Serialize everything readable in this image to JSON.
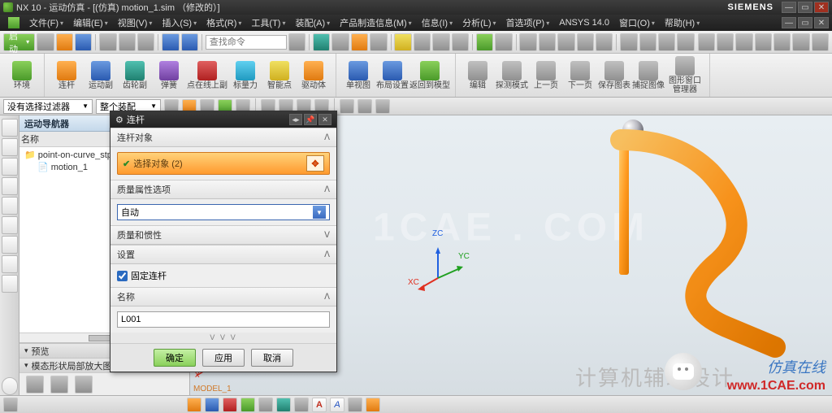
{
  "title": "NX 10 - 运动仿真 - [(仿真) motion_1.sim （修改的）]",
  "brand": "SIEMENS",
  "menu": {
    "file": "文件(F)",
    "edit": "编辑(E)",
    "view": "视图(V)",
    "insert": "插入(S)",
    "format": "格式(R)",
    "tools": "工具(T)",
    "assembly": "装配(A)",
    "pmi": "产品制造信息(M)",
    "info": "信息(I)",
    "analysis": "分析(L)",
    "preferences": "首选项(P)",
    "ansys": "ANSYS 14.0",
    "window": "窗口(O)",
    "help": "帮助(H)"
  },
  "toolbar": {
    "start": "启动",
    "search_ph": "查找命令"
  },
  "ribbon": {
    "env": "环境",
    "link": "连杆",
    "joint": "运动副",
    "gear": "齿轮副",
    "spring": "弹簧",
    "poc": "点在线上副",
    "scalar": "标量力",
    "smart": "智能点",
    "driver": "驱动体",
    "sview": "单视图",
    "layout": "布局设置",
    "back": "返回到模型",
    "edit": "编辑",
    "probe": "探测模式",
    "prev": "上一页",
    "next": "下一页",
    "save": "保存图表",
    "capture": "捕捉图像",
    "gwin": "图形窗口管理器"
  },
  "filter": {
    "nosel": "没有选择过滤器",
    "asm": "整个装配"
  },
  "nav": {
    "title": "运动导航器",
    "col_name": "名称",
    "root": "point-on-curve_stp",
    "child": "motion_1",
    "preview": "预览",
    "modeview": "模态形状局部放大图"
  },
  "dialog": {
    "title": "连杆",
    "sec_obj": "连杆对象",
    "sel": "选择对象 (2)",
    "sec_mass": "质量属性选项",
    "mass_auto": "自动",
    "sec_inertia": "质量和惯性",
    "sec_settings": "设置",
    "fixed": "固定连杆",
    "sec_name": "名称",
    "name_val": "L001",
    "ok": "确定",
    "apply": "应用",
    "cancel": "取消"
  },
  "viewport": {
    "watermark": "1CAE . COM",
    "model": "MODEL_1",
    "zc": "ZC",
    "yc": "YC",
    "xc": "XC",
    "footer": "计算机辅助设计",
    "tag": "仿真在线",
    "url": "www.1CAE.com"
  }
}
